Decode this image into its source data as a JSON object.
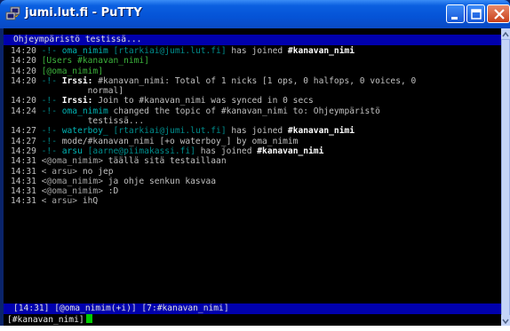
{
  "window": {
    "title": "jumi.lut.fi - PuTTY"
  },
  "topic": "Ohjeympäristö testissä...",
  "log": [
    {
      "time": "14:20",
      "mark": "-!-",
      "nick": "oma_nimim",
      "host": "[rtarkiai@jumi.lut.fi]",
      "text": "has joined",
      "chan": "#kanavan_nimi"
    },
    {
      "time": "14:20",
      "plain": "[Users #kanavan_nimi]"
    },
    {
      "time": "14:20",
      "plain": "[@oma_nimim]"
    },
    {
      "time": "14:20",
      "mark": "-!-",
      "prefix": "Irssi:",
      "text": "#kanavan_nimi: Total of 1 nicks [1 ops, 0 halfops, 0 voices, 0"
    },
    {
      "time": "",
      "cont": "normal]"
    },
    {
      "time": "14:20",
      "mark": "-!-",
      "prefix": "Irssi:",
      "text": "Join to #kanavan_nimi was synced in 0 secs"
    },
    {
      "time": "14:24",
      "mark": "-!-",
      "nick": "oma_nimim",
      "text": "changed the topic of #kanavan_nimi to: Ohjeympäristö"
    },
    {
      "time": "",
      "cont": "testissä..."
    },
    {
      "time": "14:27",
      "mark": "-!-",
      "nick": "waterboy_",
      "host": "[rtarkiai@jumi.lut.fi]",
      "text": "has joined",
      "chan": "#kanavan_nimi"
    },
    {
      "time": "14:27",
      "mark": "-!-",
      "text": "mode/#kanavan_nimi [+o waterboy_] by oma_nimim"
    },
    {
      "time": "14:29",
      "mark": "-!-",
      "nick": "arsu",
      "host": "[aarne@piimakassi.fi]",
      "text": "has joined",
      "chan": "#kanavan_nimi"
    },
    {
      "time": "14:31",
      "msg_nick": "<@oma_nimim>",
      "text": "täällä sitä testaillaan"
    },
    {
      "time": "14:31",
      "msg_nick": "< arsu>",
      "text": "no jep"
    },
    {
      "time": "14:31",
      "msg_nick": "<@oma_nimim>",
      "text": "ja ohje senkun kasvaa"
    },
    {
      "time": "14:31",
      "msg_nick": "<@oma_nimim>",
      "text": ":D"
    },
    {
      "time": "14:31",
      "msg_nick": "< arsu>",
      "text": "ihQ"
    }
  ],
  "status": "[14:31] [@oma_nimim(+i)] [7:#kanavan_nimi]",
  "prompt": "[#kanavan_nimi]"
}
